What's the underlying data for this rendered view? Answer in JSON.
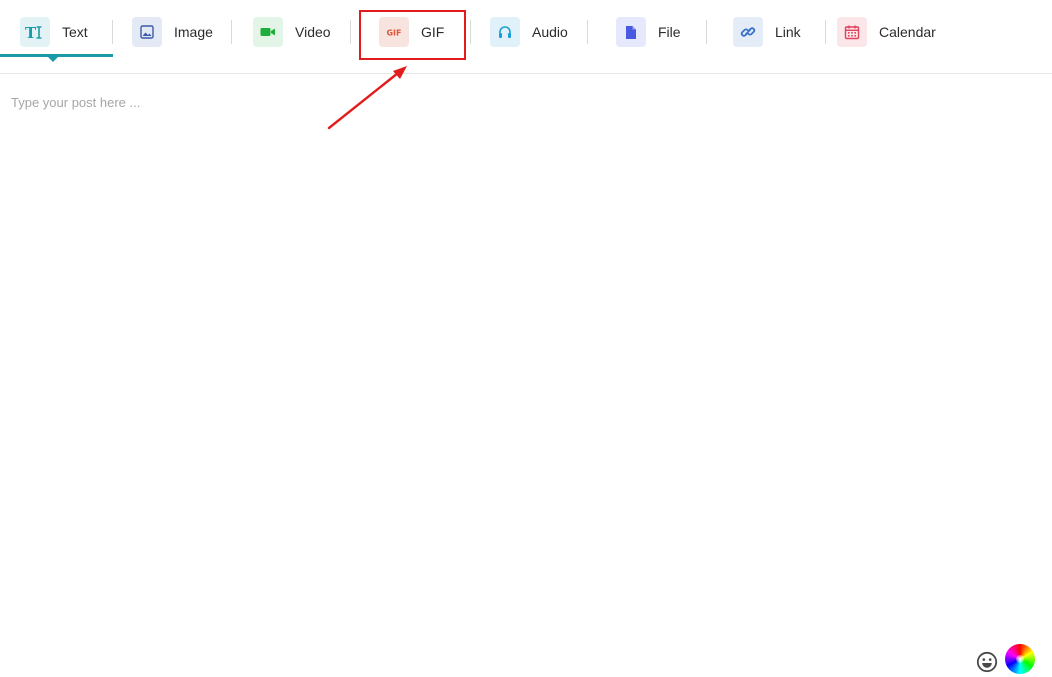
{
  "tabs": [
    {
      "id": "text",
      "label": "Text",
      "icon": "text-icon",
      "icon_color": "#1b9aaa",
      "icon_bg": "#e3f3f5",
      "active": true
    },
    {
      "id": "image",
      "label": "Image",
      "icon": "image-icon",
      "icon_color": "#3b5ba9",
      "icon_bg": "#e4e9f6"
    },
    {
      "id": "video",
      "label": "Video",
      "icon": "video-camera-icon",
      "icon_color": "#1fae3d",
      "icon_bg": "#e2f5e6"
    },
    {
      "id": "gif",
      "label": "GIF",
      "icon": "gif-icon",
      "icon_text": "GIF",
      "icon_color": "#e0553a",
      "icon_bg": "#f8e4df",
      "highlighted": true
    },
    {
      "id": "audio",
      "label": "Audio",
      "icon": "headphones-icon",
      "icon_color": "#1a9fd6",
      "icon_bg": "#e0f1fa"
    },
    {
      "id": "file",
      "label": "File",
      "icon": "file-icon",
      "icon_color": "#4a5ae0",
      "icon_bg": "#e6e8fb"
    },
    {
      "id": "link",
      "label": "Link",
      "icon": "link-icon",
      "icon_color": "#3a72c9",
      "icon_bg": "#e4ecf8"
    },
    {
      "id": "calendar",
      "label": "Calendar",
      "icon": "calendar-icon",
      "icon_color": "#e0405a",
      "icon_bg": "#fbe6ea"
    }
  ],
  "editor": {
    "placeholder": "Type your post here ..."
  },
  "footer": {
    "emoji_icon": "smiley-icon",
    "color_icon": "color-wheel-icon"
  },
  "colors": {
    "accent": "#1b9aaa",
    "annotation": "#e21c1c"
  }
}
